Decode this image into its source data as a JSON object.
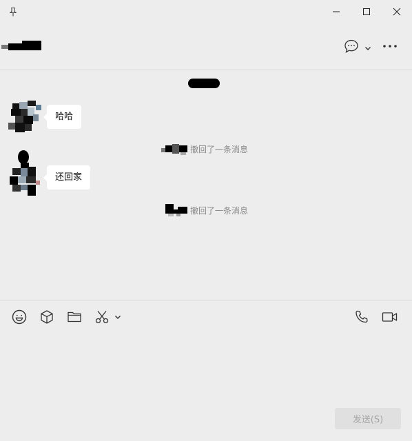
{
  "titlebar": {
    "pin_icon": "pin-icon",
    "minimize_icon": "minimize-icon",
    "maximize_icon": "maximize-icon",
    "close_icon": "close-icon"
  },
  "header": {
    "chat_icon": "chat-bubble-icon",
    "more_icon": "more-icon"
  },
  "messages": [
    {
      "type": "incoming",
      "text": "哈哈"
    },
    {
      "type": "recall",
      "text": "撤回了一条消息"
    },
    {
      "type": "incoming",
      "text": "还回家"
    },
    {
      "type": "recall",
      "text": "撤回了一条消息"
    }
  ],
  "toolbar": {
    "left": [
      "emoji-icon",
      "box-icon",
      "folder-icon",
      "scissors-icon"
    ],
    "right": [
      "phone-icon",
      "video-icon"
    ]
  },
  "send_label": "发送(S)",
  "colors": {
    "background": "#ededed",
    "bubble": "#ffffff",
    "recall_text": "#8a8a8a",
    "send_disabled_bg": "#e0e0e0",
    "send_disabled_text": "#a6a6a6"
  }
}
